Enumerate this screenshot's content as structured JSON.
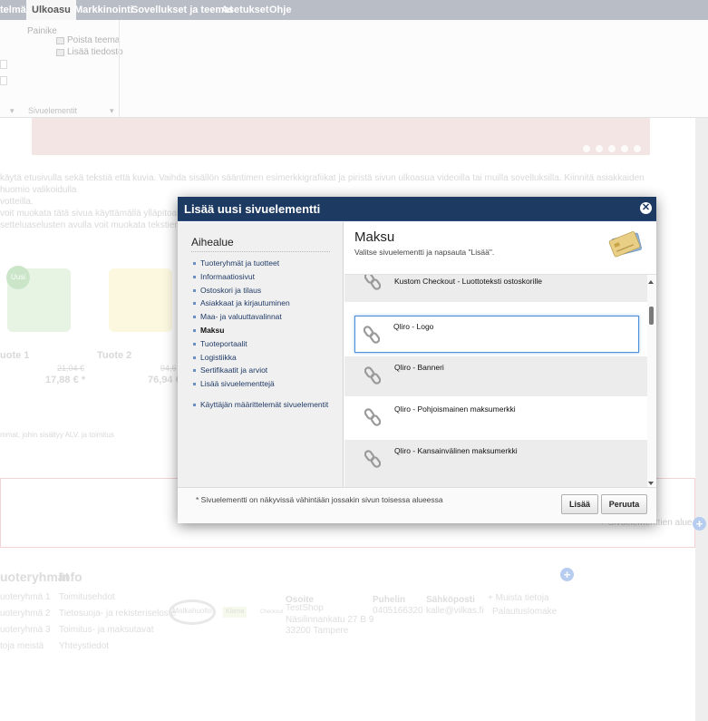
{
  "topnav": {
    "tabs": [
      {
        "label": "telmä"
      },
      {
        "label": "Ulkoasu"
      },
      {
        "label": "Markkinointi"
      },
      {
        "label": "Sovellukset ja teemat"
      },
      {
        "label": "Asetukset"
      },
      {
        "label": "Ohje"
      }
    ]
  },
  "ribbon": {
    "group_title": "Painike",
    "delete_theme": "Poista teema",
    "add_file": "Lisää tiedosto",
    "group_footer": "Sivuelementit"
  },
  "background": {
    "intro_text_1": "käytä etusivulla sekä tekstiä että kuvia. Vaihda sisällön sääntimen esimerkkigrafiikat ja piristä sivun ulkoasua videoilla tai muilla sovelluksilla. Kiinnitä asiakkaiden huomio valikoidulla",
    "intro_text_1b": "votteilla.",
    "intro_text_2": "voit muokata tätä sivua käyttämällä ylläpitoaluee",
    "intro_text_2b": "setteluaselusten avulla voit muokata tekstien, ku",
    "new_badge": "Uusi",
    "product_1": "uote 1",
    "product_2": "Tuote 2",
    "old_price_1": "21,04 €",
    "price_1": "17,88 € *",
    "old_price_2": "94,6",
    "price_2": "76,94 €",
    "vat_note": "mmat, johin sisältyy ALV. ja toimitus",
    "add_element_area": "+ Sivuelementtien alue -",
    "footer_heading_1": "uoteryhmät",
    "footer_heading_2": "Info",
    "footer_groups": [
      "uoteryhmä 1",
      "uoteryhmä 2",
      "uoteryhmä 3",
      "toja meistä"
    ],
    "footer_info": [
      "Toimitusehdot",
      "Tietosuoja- ja rekisteriseloste",
      "Toimitus- ja maksutavat",
      "Yhteystiedot"
    ],
    "footer_address_label": "Osoite",
    "footer_address": [
      "TestShop",
      "Näsilinnankatu 27 B 9",
      "33200 Tampere"
    ],
    "footer_phone_label": "Puhelin",
    "footer_phone": "0405166320",
    "footer_email_label": "Sähköposti",
    "footer_email": "kalle@vilkas.fi",
    "footer_more": "+ Muista tietoja",
    "footer_returns": "Palautuslomake",
    "footer_logo_1": "Matkahuolto",
    "footer_logo_2": "Klarna",
    "footer_logo_3": "Checkout"
  },
  "dialog": {
    "title": "Lisää uusi sivuelementti",
    "close_glyph": "✕",
    "left": {
      "heading": "Aihealue",
      "categories": [
        "Tuoteryhmät ja tuotteet",
        "Informaatiosivut",
        "Ostoskori ja tilaus",
        "Asiakkaat ja kirjautuminen",
        "Maa- ja valuuttavalinnat",
        "Maksu",
        "Tuoteportaalit",
        "Logistiikka",
        "Sertifikaatit ja arviot",
        "Lisää sivuelementtejä",
        "Käyttäjän määrittelemät sivuelementit"
      ],
      "selected_index": 5
    },
    "right": {
      "title": "Maksu",
      "subtitle": "Valitse sivuelementti ja napsauta \"Lisää\".",
      "items": [
        "Kustom Checkout - Luottoteksti ostoskorille",
        "Qliro - Logo",
        "Qliro - Banneri",
        "Qliro - Pohjoismainen maksumerkki",
        "Qliro - Kansainvälinen maksumerkki"
      ],
      "selected_index": 1
    },
    "footer": {
      "note": "* Sivuelementti on näkyvissä vähintään jossakin sivun toisessa alueessa",
      "add_label": "Lisää",
      "cancel_label": "Peruuta"
    }
  },
  "colors": {
    "dialog_header": "#1d3a63",
    "link_blue": "#203b66",
    "selection_border": "#4a90d9"
  }
}
